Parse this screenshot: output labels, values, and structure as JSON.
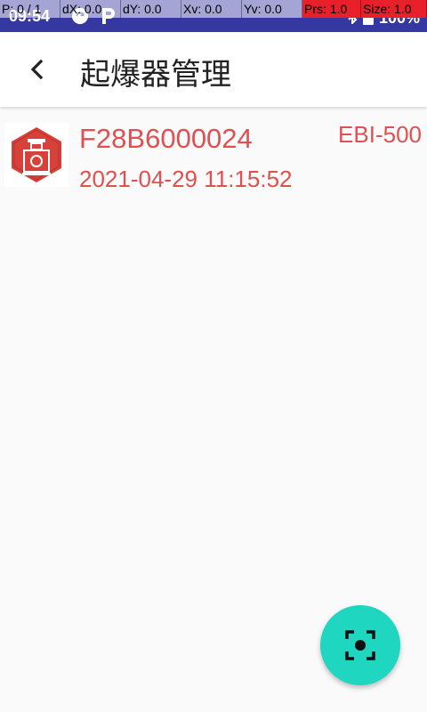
{
  "status_bar": {
    "time": "09:54",
    "battery": "100%",
    "icons": [
      "sync-icon",
      "parking-icon",
      "bluetooth-icon",
      "battery-icon"
    ]
  },
  "pointer_overlay": {
    "p": "P: 0 / 1",
    "dx": "dX: 0.0",
    "dy": "dY: 0.0",
    "xv": "Xv: 0.0",
    "yv": "Yv: 0.0",
    "prs": "Prs: 1.0",
    "size": "Size: 1.0"
  },
  "app_bar": {
    "title": "起爆器管理",
    "back_icon": "chevron-left-icon"
  },
  "devices": [
    {
      "id": "F28B6000024",
      "model": "EBI-500",
      "timestamp": "2021-04-29 11:15:52",
      "icon": "detonator-icon"
    }
  ],
  "fab": {
    "icon": "scan-icon"
  },
  "colors": {
    "status_bar": "#3538a0",
    "accent_text": "#e05050",
    "fab": "#1fd6c0",
    "thumb_hex": "#d8413a"
  }
}
